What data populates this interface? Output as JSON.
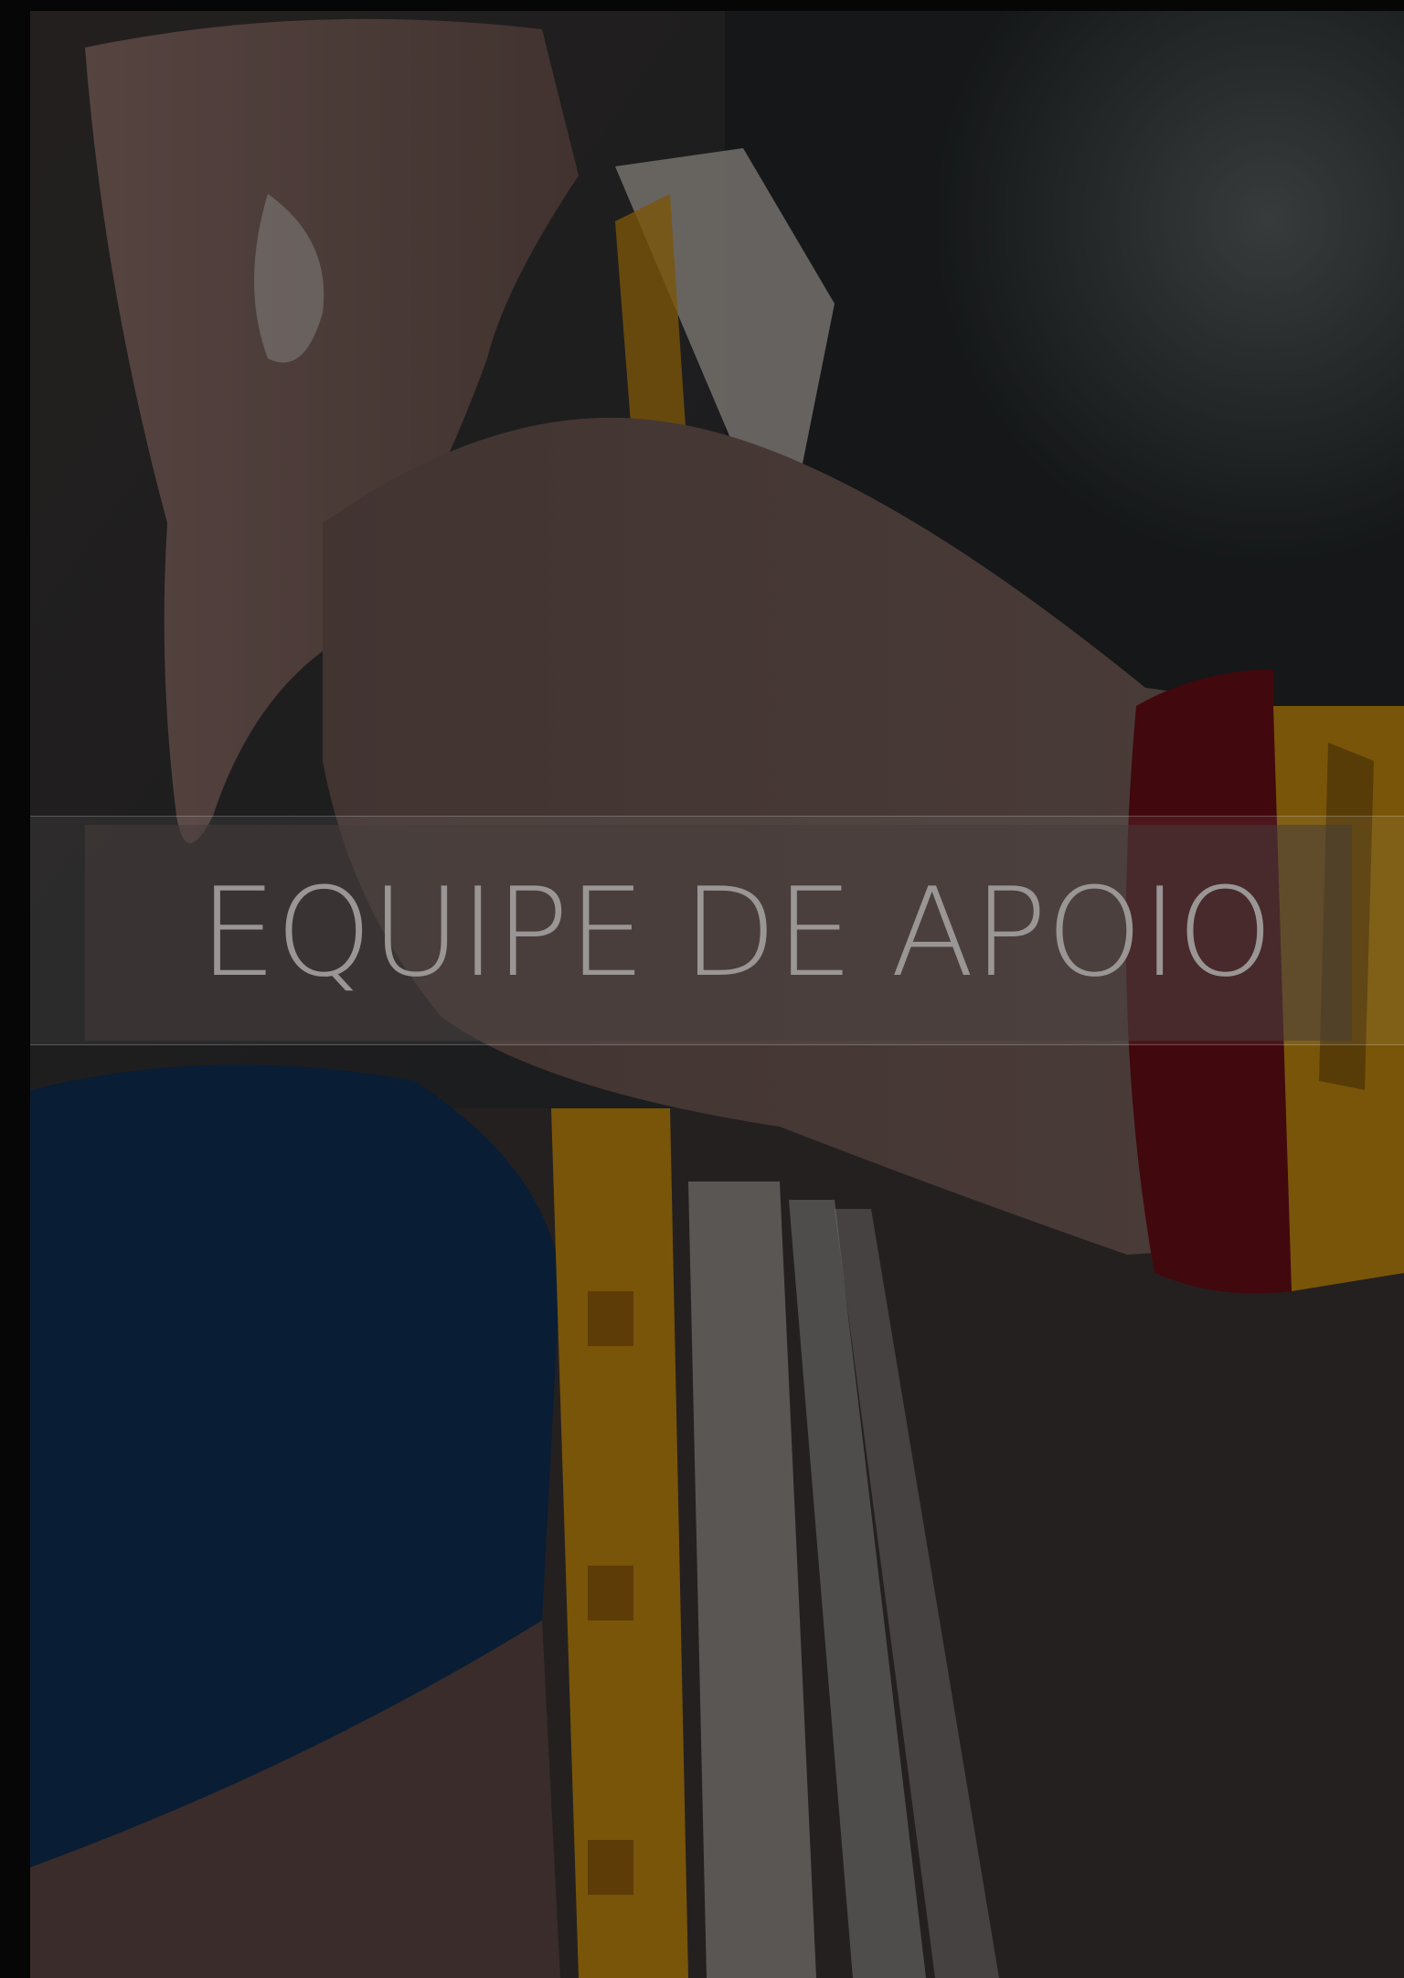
{
  "banner": {
    "title": "EQUIPE DE APOIO"
  },
  "photo": {
    "subject": "hands-with-festival-wristbands",
    "colors": {
      "skin": "#6b5550",
      "shirt": "#0f2f55",
      "wristband_yellow": "#c48a10",
      "bracelet_red": "#6a0d18",
      "background_dark": "#2a2d30"
    }
  }
}
